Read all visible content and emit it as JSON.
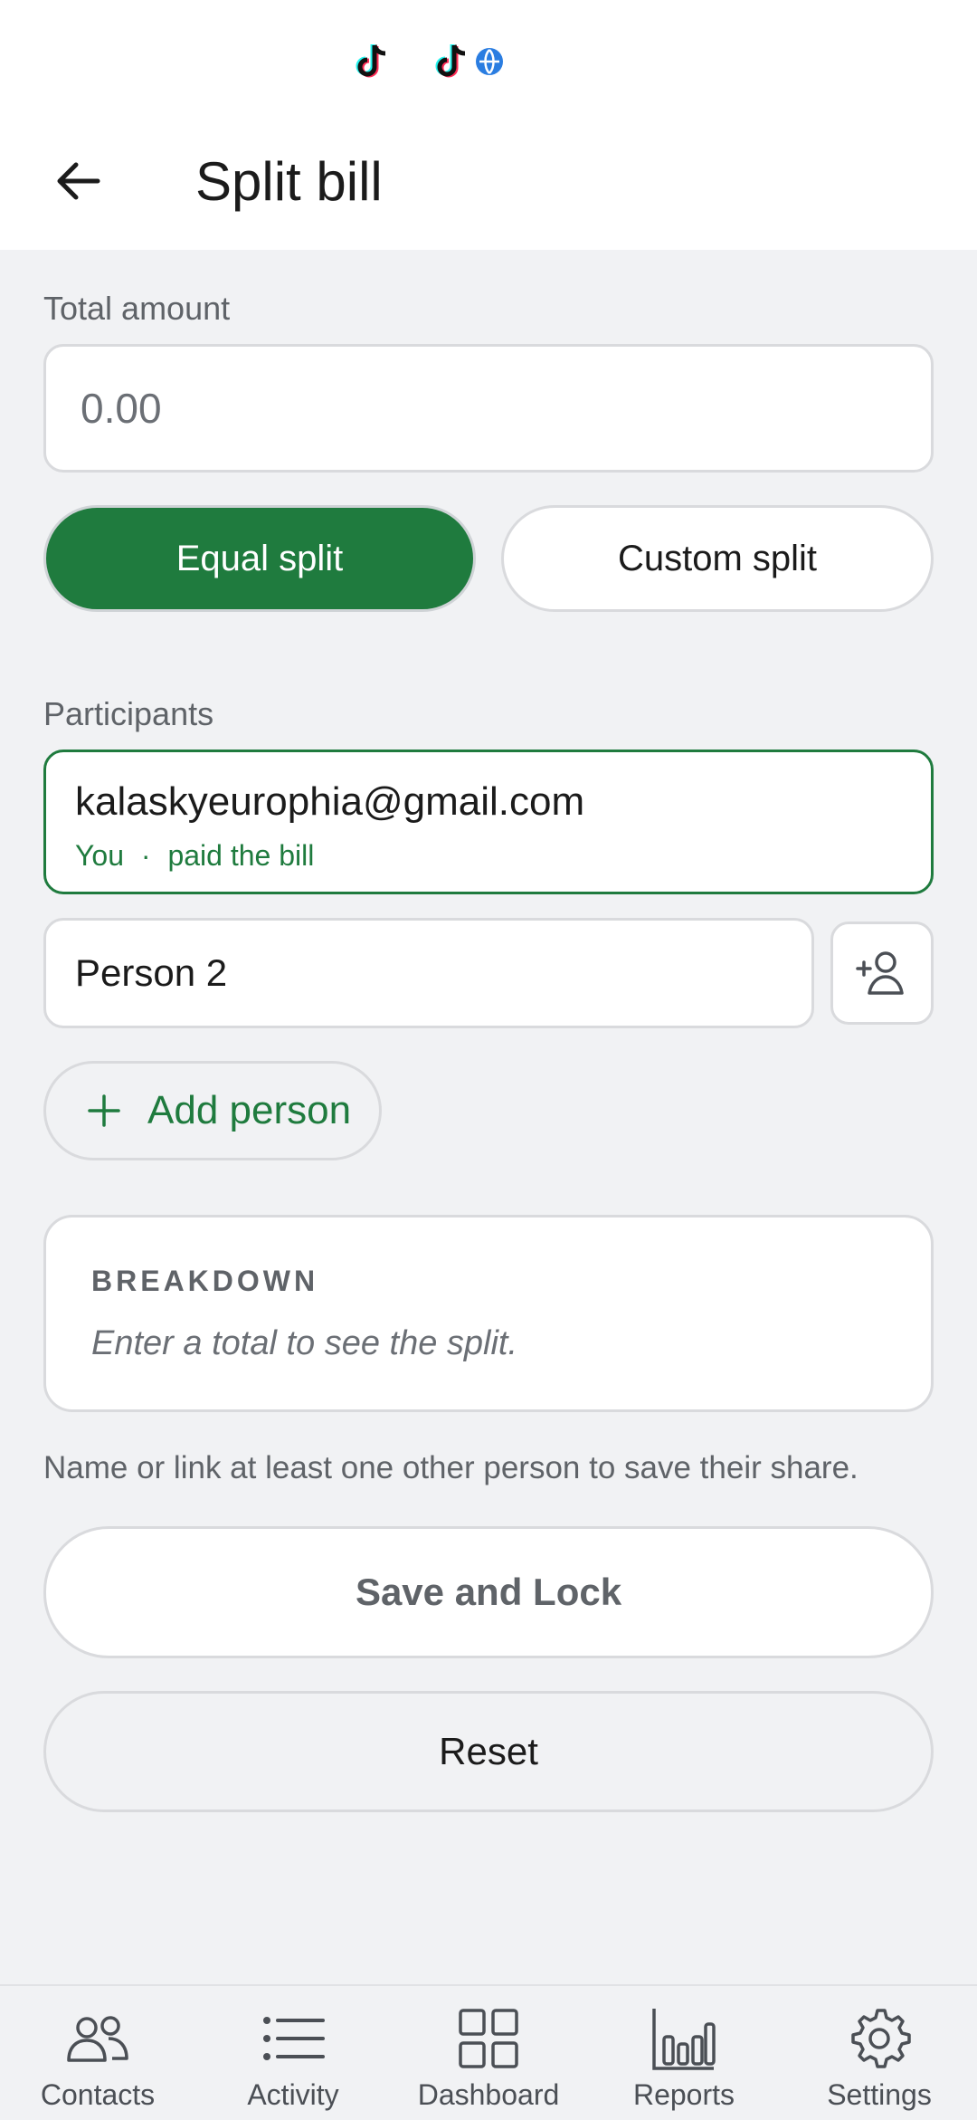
{
  "status_bar": {
    "icons": [
      "tiktok-icon",
      "tiktok-icon",
      "globe-badge-icon"
    ]
  },
  "app_bar": {
    "title": "Split bill",
    "back_icon": "arrow-left-icon"
  },
  "total_amount": {
    "label": "Total amount",
    "placeholder": "0.00"
  },
  "split_mode": {
    "options": [
      "Equal split",
      "Custom split"
    ],
    "selected": "Equal split",
    "accent": "#1f7b3e"
  },
  "participants": {
    "label": "Participants",
    "main": {
      "email": "kalaskyeurophia@gmail.com",
      "you": "You",
      "separator": "·",
      "status": "paid the bill"
    },
    "second": {
      "name": "Person 2",
      "link_icon": "person-add-icon"
    },
    "add_label": "Add person"
  },
  "breakdown": {
    "title": "BREAKDOWN",
    "hint": "Enter a total to see the split."
  },
  "info": "Name or link at least one other person to save their share.",
  "actions": {
    "save": "Save and Lock",
    "reset": "Reset"
  },
  "bottom_nav": {
    "items": [
      {
        "label": "Contacts",
        "icon": "people-icon"
      },
      {
        "label": "Activity",
        "icon": "list-icon"
      },
      {
        "label": "Dashboard",
        "icon": "grid-icon"
      },
      {
        "label": "Reports",
        "icon": "bar-chart-icon"
      },
      {
        "label": "Settings",
        "icon": "gear-icon"
      }
    ]
  }
}
